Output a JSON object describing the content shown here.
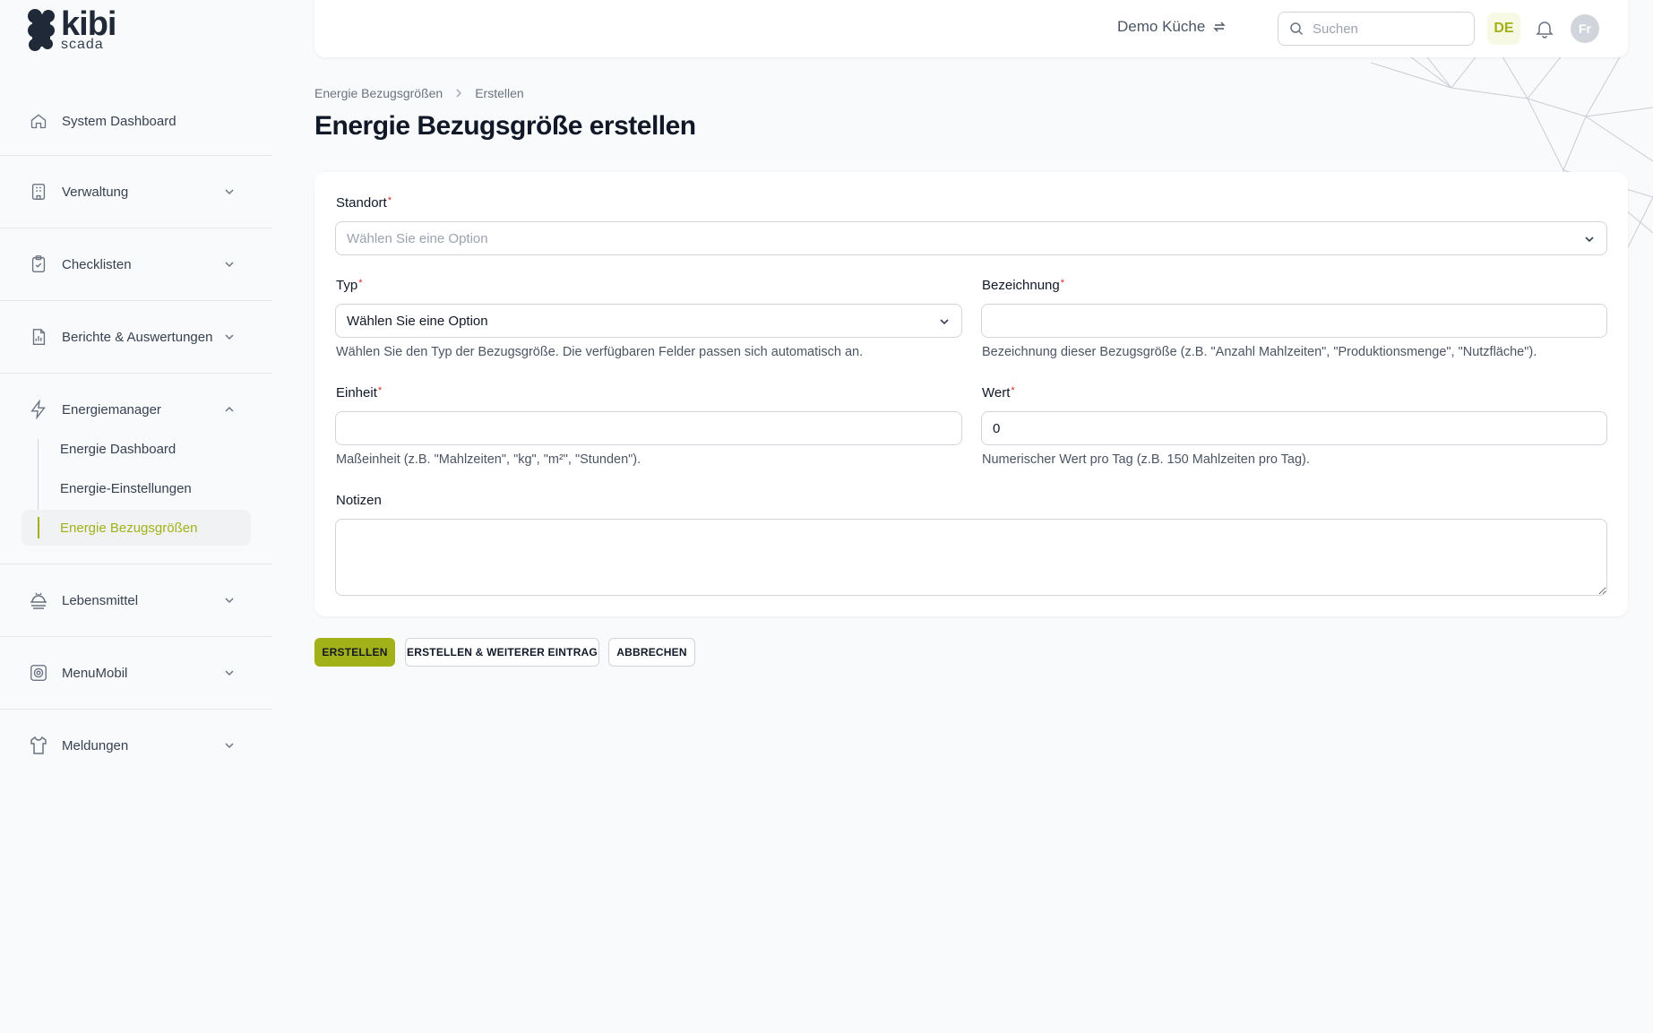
{
  "app": {
    "logo_name": "kibi",
    "logo_sub": "scada"
  },
  "sidebar": {
    "items": [
      {
        "label": "System Dashboard",
        "icon": "home-icon"
      },
      {
        "label": "Verwaltung",
        "icon": "building-icon"
      },
      {
        "label": "Checklisten",
        "icon": "clipboard-check-icon"
      },
      {
        "label": "Berichte & Auswertungen",
        "icon": "report-chart-icon"
      },
      {
        "label": "Energiemanager",
        "icon": "bolt-icon"
      },
      {
        "label": "Lebensmittel",
        "icon": "food-icon"
      },
      {
        "label": "MenuMobil",
        "icon": "plate-icon"
      },
      {
        "label": "Meldungen",
        "icon": "shirt-icon"
      }
    ],
    "energy_sub": [
      {
        "label": "Energie Dashboard"
      },
      {
        "label": "Energie-Einstellungen"
      },
      {
        "label": "Energie Bezugsgrößen",
        "active": true
      }
    ],
    "active_color": "#a3b119"
  },
  "topbar": {
    "tenant": "Demo Küche",
    "search_placeholder": "Suchen",
    "language": "DE",
    "avatar_initials": "Fr"
  },
  "breadcrumb": [
    "Energie Bezugsgrößen",
    "Erstellen"
  ],
  "page_title": "Energie Bezugsgröße erstellen",
  "form": {
    "standort": {
      "label": "Standort",
      "placeholder": "Wählen Sie eine Option"
    },
    "typ": {
      "label": "Typ",
      "value": "Wählen Sie eine Option",
      "hint": "Wählen Sie den Typ der Bezugsgröße. Die verfügbaren Felder passen sich automatisch an."
    },
    "bezeichnung": {
      "label": "Bezeichnung",
      "value": "",
      "hint": "Bezeichnung dieser Bezugsgröße (z.B. \"Anzahl Mahlzeiten\", \"Produktionsmenge\", \"Nutzfläche\")."
    },
    "einheit": {
      "label": "Einheit",
      "value": "",
      "hint": "Maßeinheit (z.B. \"Mahlzeiten\", \"kg\", \"m²\", \"Stunden\")."
    },
    "wert": {
      "label": "Wert",
      "value": "0",
      "hint": "Numerischer Wert pro Tag (z.B. 150 Mahlzeiten pro Tag)."
    },
    "notizen": {
      "label": "Notizen",
      "value": ""
    },
    "required_marker": "*"
  },
  "buttons": {
    "create": "ERSTELLEN",
    "create_another": "ERSTELLEN & WEITERER EINTRAG",
    "cancel": "ABBRECHEN"
  },
  "colors": {
    "accent": "#a3b119",
    "required": "#dc2626"
  }
}
